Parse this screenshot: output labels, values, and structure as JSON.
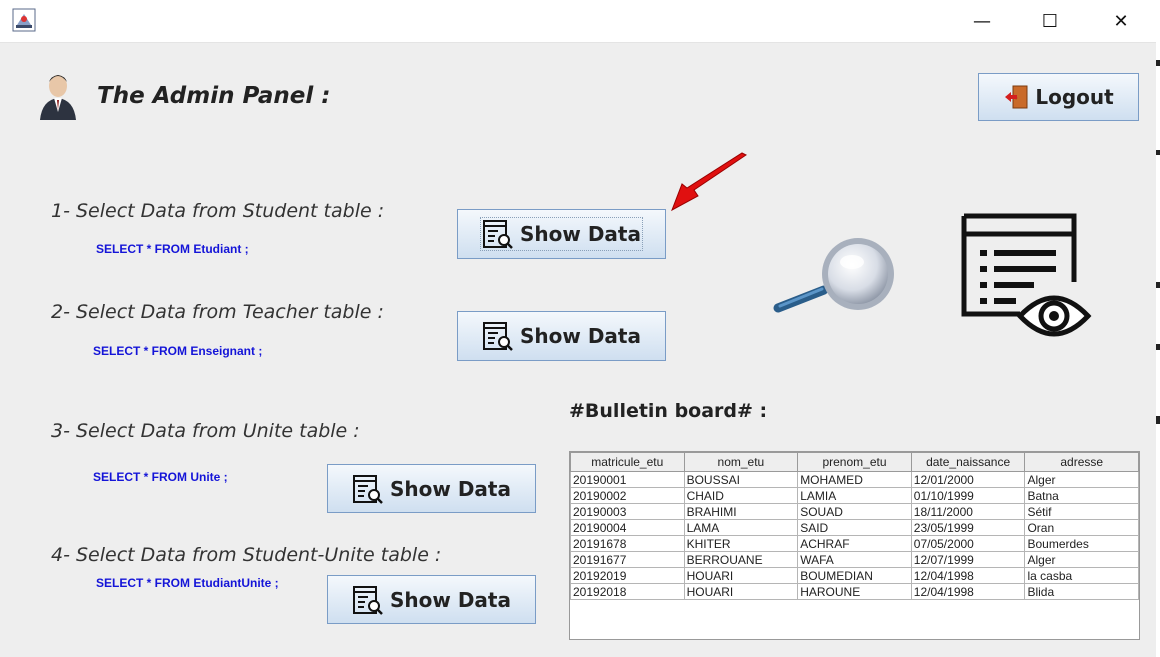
{
  "window": {
    "title": "",
    "minimize": "—",
    "maximize": "☐",
    "close": "✕"
  },
  "header": {
    "title": "The Admin Panel  :",
    "logout_label": "Logout"
  },
  "sections": [
    {
      "label": "1- Select Data from Student table :",
      "sql": "SELECT *  FROM  Etudiant ;",
      "button": "Show Data"
    },
    {
      "label": "2- Select Data from Teacher table :",
      "sql": "SELECT * FROM Enseignant ;",
      "button": "Show Data"
    },
    {
      "label": "3- Select Data from Unite table :",
      "sql": "SELECT * FROM Unite ;",
      "button": "Show Data"
    },
    {
      "label": "4- Select Data from Student-Unite table :",
      "sql": "SELECT * FROM EtudiantUnite ;",
      "button": "Show Data"
    }
  ],
  "bulletin": {
    "title": "#Bulletin board# :",
    "columns": [
      "matricule_etu",
      "nom_etu",
      "prenom_etu",
      "date_naissance",
      "adresse"
    ],
    "rows": [
      [
        "20190001",
        "BOUSSAI",
        "MOHAMED",
        "12/01/2000",
        "Alger"
      ],
      [
        "20190002",
        "CHAID",
        "LAMIA",
        "01/10/1999",
        "Batna"
      ],
      [
        "20190003",
        "BRAHIMI",
        "SOUAD",
        "18/11/2000",
        "Sétif"
      ],
      [
        "20190004",
        "LAMA",
        "SAID",
        "23/05/1999",
        "Oran"
      ],
      [
        "20191678",
        "KHITER",
        "ACHRAF",
        "07/05/2000",
        "Boumerdes"
      ],
      [
        "20191677",
        "BERROUANE",
        "WAFA",
        "12/07/1999",
        "Alger"
      ],
      [
        "20192019",
        "HOUARI",
        "BOUMEDIAN",
        "12/04/1998",
        "la casba"
      ],
      [
        "20192018",
        "HOUARI",
        "HAROUNE",
        "12/04/1998",
        "Blida"
      ]
    ]
  },
  "icons": {
    "app": "java-app-icon",
    "admin": "admin-user-icon",
    "logout": "logout-door-icon",
    "show": "table-search-icon",
    "arrow": "red-arrow-icon",
    "magnifier": "magnifier-icon",
    "doc": "document-eye-icon"
  }
}
